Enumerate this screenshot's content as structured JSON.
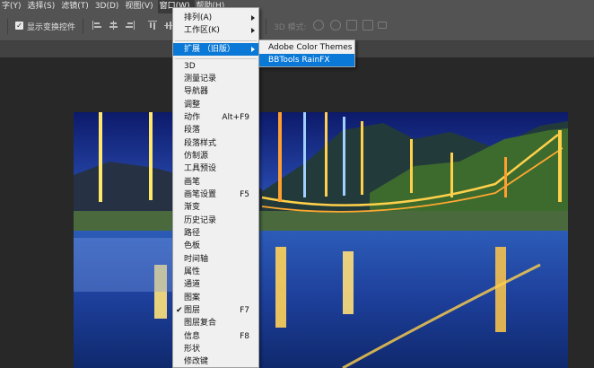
{
  "menubar": {
    "items": [
      "字(Y)",
      "选择(S)",
      "滤镜(T)",
      "3D(D)",
      "视图(V)",
      "窗口(W)",
      "帮助(H)"
    ],
    "active_index": 5
  },
  "options_bar": {
    "show_transform_label": "显示变换控件",
    "show_transform_checked": true,
    "mode_3d_label": "3D 模式:"
  },
  "window_menu": {
    "items": [
      {
        "label": "排列(A)",
        "shortcut": "",
        "submenu": true
      },
      {
        "label": "工作区(K)",
        "shortcut": "",
        "submenu": true
      },
      {
        "label": "扩展 （旧版）",
        "shortcut": "",
        "submenu": true,
        "highlighted": true
      },
      {
        "label": "3D",
        "shortcut": ""
      },
      {
        "label": "测量记录",
        "shortcut": ""
      },
      {
        "label": "导航器",
        "shortcut": ""
      },
      {
        "label": "调整",
        "shortcut": ""
      },
      {
        "label": "动作",
        "shortcut": "Alt+F9"
      },
      {
        "label": "段落",
        "shortcut": ""
      },
      {
        "label": "段落样式",
        "shortcut": ""
      },
      {
        "label": "仿制源",
        "shortcut": ""
      },
      {
        "label": "工具预设",
        "shortcut": ""
      },
      {
        "label": "画笔",
        "shortcut": ""
      },
      {
        "label": "画笔设置",
        "shortcut": "F5"
      },
      {
        "label": "渐变",
        "shortcut": ""
      },
      {
        "label": "历史记录",
        "shortcut": ""
      },
      {
        "label": "路径",
        "shortcut": ""
      },
      {
        "label": "色板",
        "shortcut": ""
      },
      {
        "label": "时间轴",
        "shortcut": ""
      },
      {
        "label": "属性",
        "shortcut": ""
      },
      {
        "label": "通道",
        "shortcut": ""
      },
      {
        "label": "图案",
        "shortcut": ""
      },
      {
        "label": "图层",
        "shortcut": "F7",
        "checked": true
      },
      {
        "label": "图层复合",
        "shortcut": ""
      },
      {
        "label": "信息",
        "shortcut": "F8"
      },
      {
        "label": "形状",
        "shortcut": ""
      },
      {
        "label": "修改键",
        "shortcut": ""
      }
    ]
  },
  "extensions_submenu": {
    "items": [
      {
        "label": "Adobe Color Themes",
        "highlighted": false
      },
      {
        "label": "BBTools RainFX",
        "highlighted": true
      }
    ]
  },
  "colors": {
    "highlight": "#0a78d6",
    "menu_bg": "#f0f0f0",
    "app_bg": "#535353"
  }
}
